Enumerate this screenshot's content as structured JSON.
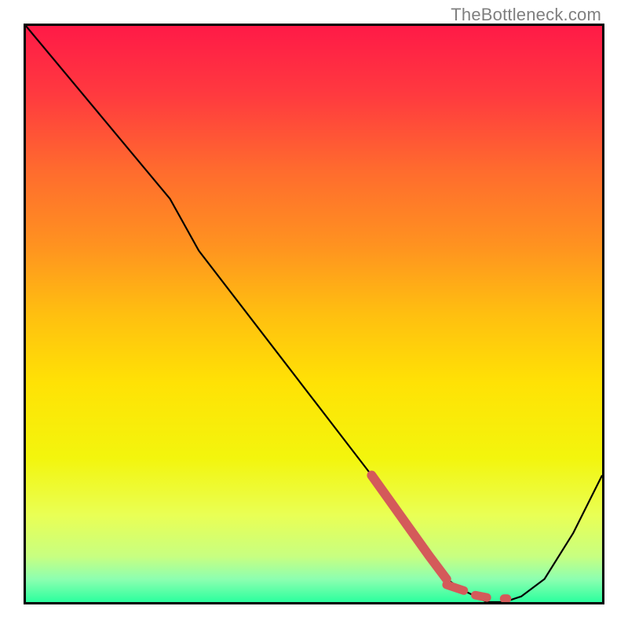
{
  "watermark": {
    "text": "TheBottleneck.com"
  },
  "gradient": {
    "stops": [
      {
        "offset": 0.0,
        "color": "#ff1a47"
      },
      {
        "offset": 0.12,
        "color": "#ff3a3f"
      },
      {
        "offset": 0.25,
        "color": "#ff6b2e"
      },
      {
        "offset": 0.38,
        "color": "#ff9220"
      },
      {
        "offset": 0.5,
        "color": "#ffbf10"
      },
      {
        "offset": 0.62,
        "color": "#ffe205"
      },
      {
        "offset": 0.75,
        "color": "#f3f50d"
      },
      {
        "offset": 0.85,
        "color": "#e9ff55"
      },
      {
        "offset": 0.92,
        "color": "#c8ff80"
      },
      {
        "offset": 0.96,
        "color": "#8dffb0"
      },
      {
        "offset": 1.0,
        "color": "#2bff9e"
      }
    ]
  },
  "chart_data": {
    "type": "line",
    "title": "",
    "xlabel": "",
    "ylabel": "",
    "xlim": [
      0,
      100
    ],
    "ylim": [
      0,
      100
    ],
    "x": [
      0,
      10,
      20,
      25,
      30,
      40,
      50,
      60,
      65,
      70,
      73,
      76,
      78,
      80,
      83,
      86,
      90,
      95,
      100
    ],
    "values": [
      100,
      88,
      76,
      70,
      61,
      48,
      35,
      22,
      15,
      8,
      4,
      2,
      1,
      0,
      0,
      1,
      4,
      12,
      22
    ],
    "highlight": {
      "color": "#d45a5a",
      "segments": [
        {
          "x": [
            60,
            65,
            70,
            73
          ],
          "y": [
            22,
            15,
            8,
            4
          ]
        },
        {
          "x": [
            73,
            76
          ],
          "y": [
            3,
            2
          ]
        },
        {
          "x": [
            78,
            80
          ],
          "y": [
            1.2,
            0.8
          ]
        },
        {
          "x": [
            83,
            83.5
          ],
          "y": [
            0.6,
            0.6
          ]
        }
      ]
    }
  }
}
